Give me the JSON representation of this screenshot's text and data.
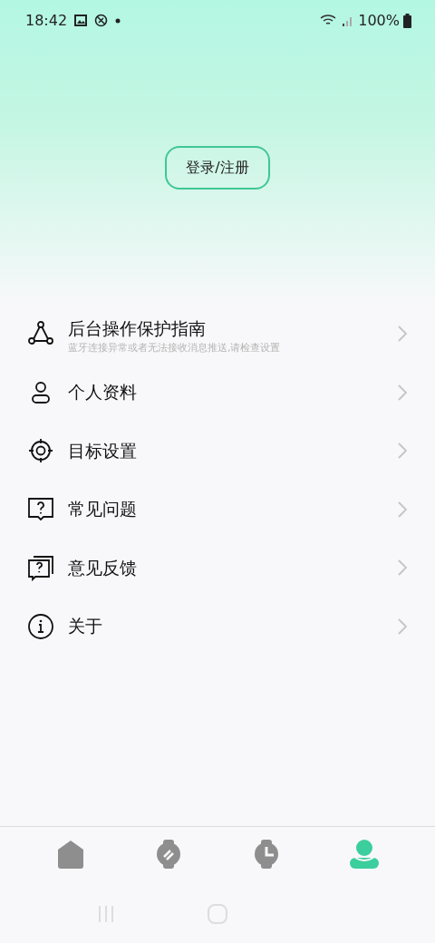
{
  "status_bar": {
    "time": "18:42",
    "battery": "100%"
  },
  "login_button": "登录/注册",
  "menu": [
    {
      "kind": "guide",
      "label": "后台操作保护指南",
      "subtitle": "蓝牙连接异常或者无法接收消息推送,请检查设置"
    },
    {
      "kind": "profile",
      "label": "个人资料"
    },
    {
      "kind": "target",
      "label": "目标设置"
    },
    {
      "kind": "faq",
      "label": "常见问题"
    },
    {
      "kind": "feedback",
      "label": "意见反馈"
    },
    {
      "kind": "about",
      "label": "关于"
    }
  ],
  "tabs": [
    {
      "kind": "home",
      "selected": false
    },
    {
      "kind": "watch",
      "selected": false
    },
    {
      "kind": "clock",
      "selected": false
    },
    {
      "kind": "user",
      "selected": true
    }
  ]
}
